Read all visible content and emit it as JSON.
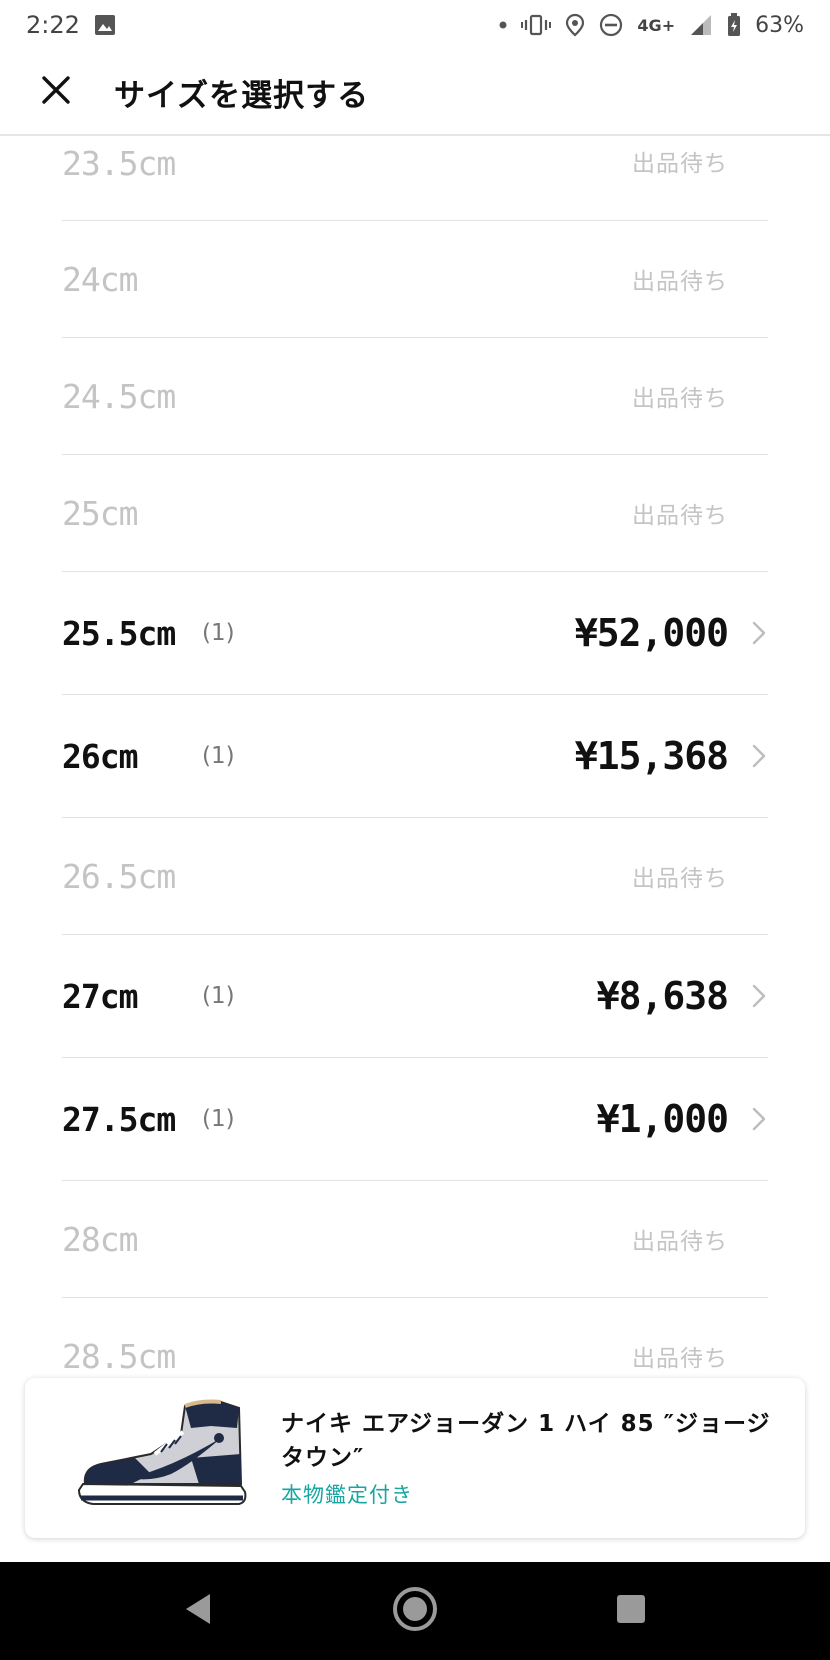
{
  "status_bar": {
    "time": "2:22",
    "network": "4G+",
    "battery": "63%"
  },
  "header": {
    "title": "サイズを選択する"
  },
  "sizes": [
    {
      "size": "23.5cm",
      "available": false,
      "waiting_label": "出品待ち"
    },
    {
      "size": "24cm",
      "available": false,
      "waiting_label": "出品待ち"
    },
    {
      "size": "24.5cm",
      "available": false,
      "waiting_label": "出品待ち"
    },
    {
      "size": "25cm",
      "available": false,
      "waiting_label": "出品待ち"
    },
    {
      "size": "25.5cm",
      "available": true,
      "count": "(1)",
      "price": "¥52,000"
    },
    {
      "size": "26cm",
      "available": true,
      "count": "(1)",
      "price": "¥15,368"
    },
    {
      "size": "26.5cm",
      "available": false,
      "waiting_label": "出品待ち"
    },
    {
      "size": "27cm",
      "available": true,
      "count": "(1)",
      "price": "¥8,638"
    },
    {
      "size": "27.5cm",
      "available": true,
      "count": "(1)",
      "price": "¥1,000"
    },
    {
      "size": "28cm",
      "available": false,
      "waiting_label": "出品待ち"
    },
    {
      "size": "28.5cm",
      "available": false,
      "waiting_label": "出品待ち"
    }
  ],
  "product": {
    "name": "ナイキ エアジョーダン 1 ハイ 85 ″ジョージタウン″",
    "badge": "本物鑑定付き"
  },
  "colors": {
    "accent_teal": "#1aa6a0",
    "waiting_gray": "#c4c4c4",
    "shoe_navy": "#1f2a44"
  }
}
